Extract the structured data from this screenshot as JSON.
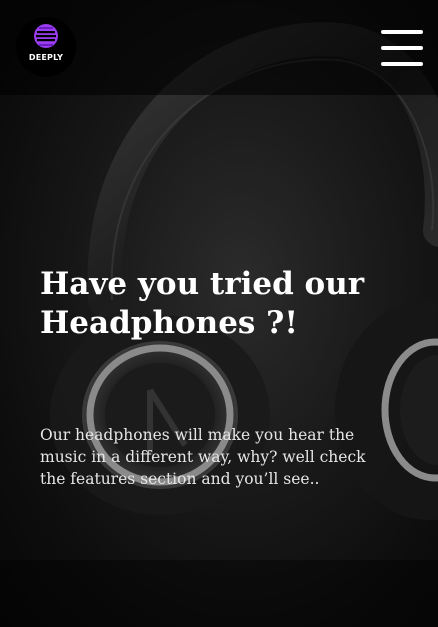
{
  "header": {
    "logo_text": "DEEPLY",
    "logo_accent": "#9b3cf0",
    "menu_icon": "hamburger-menu-icon"
  },
  "hero": {
    "headline": "Have you tried our Headphones ?!",
    "subtext": "Our headphones will make you hear the music in a different way, why? well check the features section and you’ll see..",
    "background_image": "headphones-photo"
  },
  "colors": {
    "text": "#ffffff",
    "background": "#111111"
  }
}
